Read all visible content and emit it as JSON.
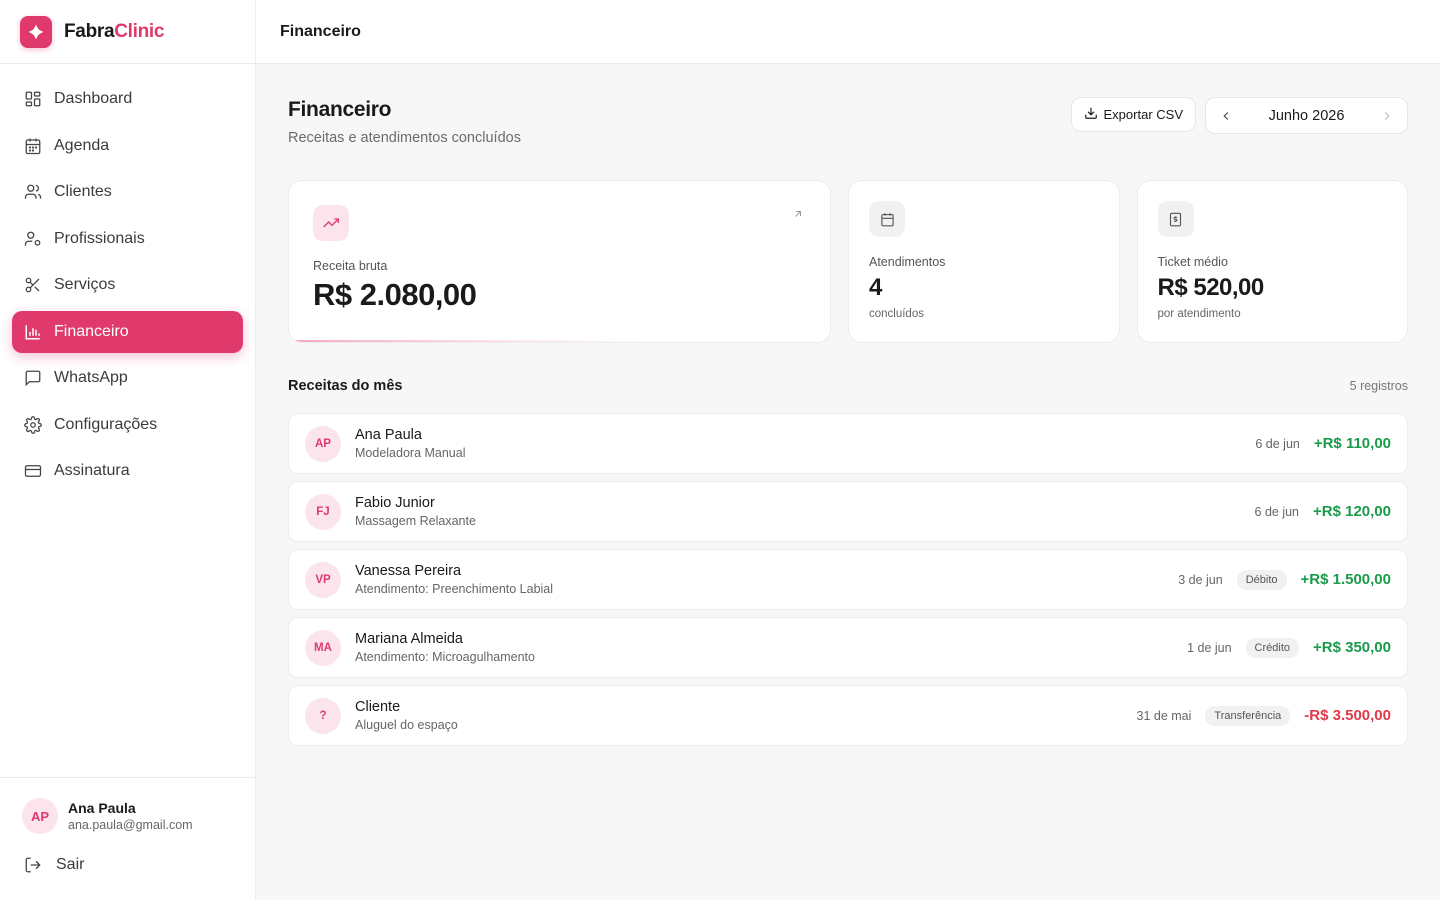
{
  "brand": {
    "name_part1": "Fabra",
    "name_part2": "Clinic"
  },
  "sidebar": {
    "items": [
      {
        "label": "Dashboard",
        "icon": "dashboard-icon"
      },
      {
        "label": "Agenda",
        "icon": "calendar-icon"
      },
      {
        "label": "Clientes",
        "icon": "users-icon"
      },
      {
        "label": "Profissionais",
        "icon": "user-cog-icon"
      },
      {
        "label": "Serviços",
        "icon": "scissors-icon"
      },
      {
        "label": "Financeiro",
        "icon": "bar-chart-icon",
        "active": true
      },
      {
        "label": "WhatsApp",
        "icon": "message-icon"
      },
      {
        "label": "Configurações",
        "icon": "gear-icon"
      },
      {
        "label": "Assinatura",
        "icon": "credit-card-icon"
      }
    ],
    "user": {
      "initials": "AP",
      "name": "Ana Paula",
      "email": "ana.paula@gmail.com"
    },
    "logout_label": "Sair"
  },
  "topbar": {
    "title": "Financeiro"
  },
  "page": {
    "title": "Financeiro",
    "subtitle": "Receitas e atendimentos concluídos",
    "export_label": "Exportar CSV",
    "month": "Junho 2026"
  },
  "stats": {
    "revenue": {
      "label": "Receita bruta",
      "value": "R$ 2.080,00"
    },
    "appointments": {
      "label": "Atendimentos",
      "value": "4",
      "sub": "concluídos"
    },
    "ticket": {
      "label": "Ticket médio",
      "value": "R$ 520,00",
      "sub": "por atendimento"
    }
  },
  "transactions_section": {
    "title": "Receitas do mês",
    "count": "5 registros"
  },
  "transactions": [
    {
      "initials": "AP",
      "name": "Ana Paula",
      "desc": "Modeladora Manual",
      "date": "6 de jun",
      "badge": "",
      "amount": "+R$ 110,00",
      "negative": false
    },
    {
      "initials": "FJ",
      "name": "Fabio Junior",
      "desc": "Massagem Relaxante",
      "date": "6 de jun",
      "badge": "",
      "amount": "+R$ 120,00",
      "negative": false
    },
    {
      "initials": "VP",
      "name": "Vanessa Pereira",
      "desc": "Atendimento: Preenchimento Labial",
      "date": "3 de jun",
      "badge": "Débito",
      "amount": "+R$ 1.500,00",
      "negative": false
    },
    {
      "initials": "MA",
      "name": "Mariana Almeida",
      "desc": "Atendimento: Microagulhamento",
      "date": "1 de jun",
      "badge": "Crédito",
      "amount": "+R$ 350,00",
      "negative": false
    },
    {
      "initials": "?",
      "name": "Cliente",
      "desc": "Aluguel do espaço",
      "date": "31 de mai",
      "badge": "Transferência",
      "amount": "-R$ 3.500,00",
      "negative": true
    }
  ],
  "colors": {
    "accent": "#e03a6c",
    "positive": "#1a9b4b",
    "negative": "#e03a4a"
  }
}
